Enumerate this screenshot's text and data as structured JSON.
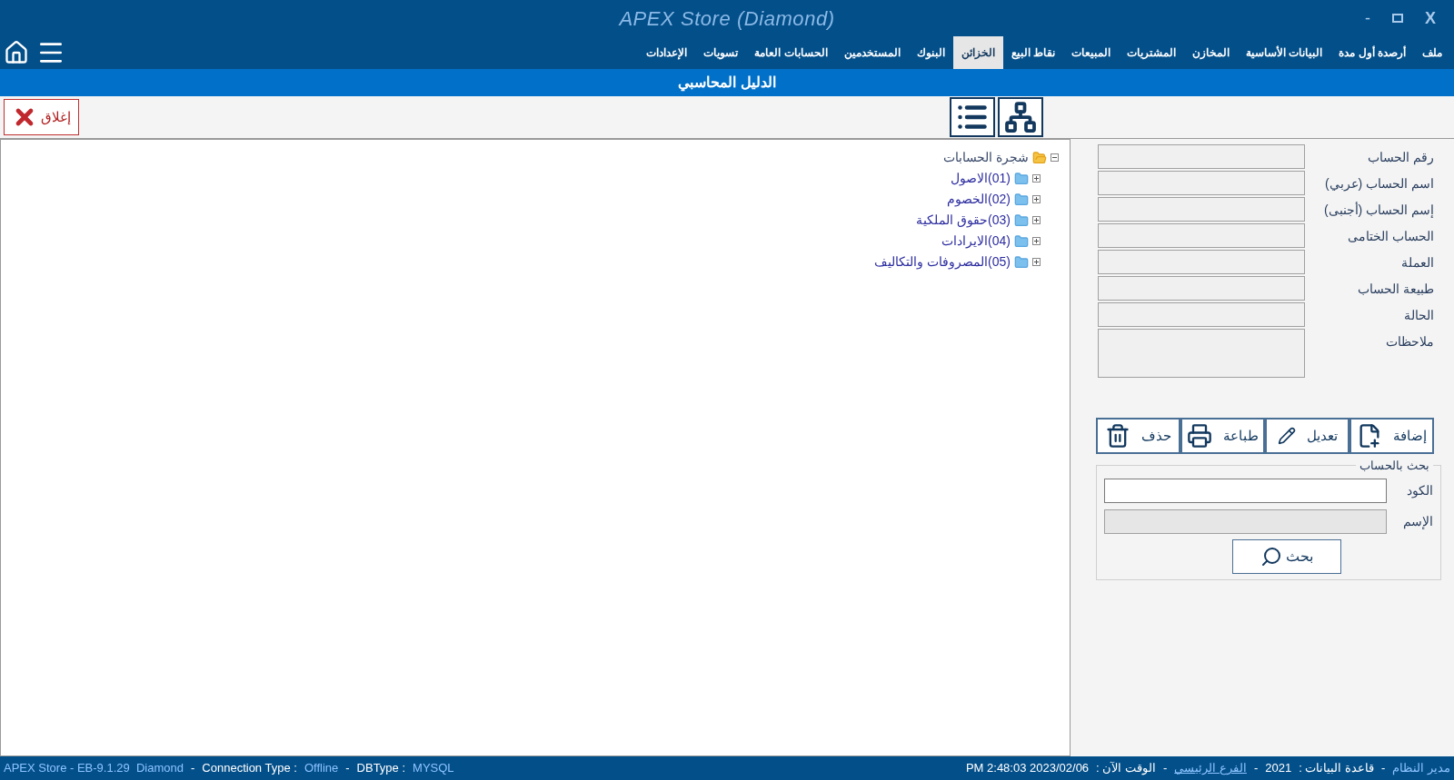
{
  "window": {
    "title": "APEX Store (Diamond)",
    "minimize": "-",
    "close": "X"
  },
  "menu": [
    {
      "label": "ملف",
      "selected": false
    },
    {
      "label": "أرصدة أول مدة",
      "selected": false
    },
    {
      "label": "البيانات الأساسية",
      "selected": false
    },
    {
      "label": "المخازن",
      "selected": false
    },
    {
      "label": "المشتريات",
      "selected": false
    },
    {
      "label": "المبيعات",
      "selected": false
    },
    {
      "label": "نقاط البيع",
      "selected": false
    },
    {
      "label": "الخزائن",
      "selected": true
    },
    {
      "label": "البنوك",
      "selected": false
    },
    {
      "label": "المستخدمين",
      "selected": false
    },
    {
      "label": "الحسابات العامة",
      "selected": false
    },
    {
      "label": "تسويات",
      "selected": false
    },
    {
      "label": "الإعدادات",
      "selected": false
    }
  ],
  "page_title": "الدليل المحاسبي",
  "close_button": "إغلاق",
  "tree": {
    "label": "شجرة الحسابات",
    "expanded": true,
    "children": [
      {
        "label": "(01)الاصول",
        "expanded": false
      },
      {
        "label": "(02)الخصوم",
        "expanded": false
      },
      {
        "label": "(03)حقوق الملكية",
        "expanded": false
      },
      {
        "label": "(04)الايرادات",
        "expanded": false
      },
      {
        "label": "(05)المصروفات والتكاليف",
        "expanded": false
      }
    ]
  },
  "form": [
    {
      "label": "رقم الحساب",
      "kind": "line",
      "disabled": true
    },
    {
      "label": "اسم الحساب (عربي)",
      "kind": "line",
      "disabled": true
    },
    {
      "label": "إسم الحساب (أجنبى)",
      "kind": "line",
      "disabled": true
    },
    {
      "label": "الحساب الختامى",
      "kind": "line",
      "disabled": true
    },
    {
      "label": "العملة",
      "kind": "line",
      "disabled": true
    },
    {
      "label": "طبيعة الحساب",
      "kind": "line",
      "disabled": true
    },
    {
      "label": "الحالة",
      "kind": "line",
      "disabled": true
    },
    {
      "label": "ملاحظات",
      "kind": "multiline",
      "disabled": true
    }
  ],
  "actions": [
    {
      "label": "إضافة",
      "kind": "add"
    },
    {
      "label": "تعديل",
      "kind": "edit"
    },
    {
      "label": "طباعة",
      "kind": "print"
    },
    {
      "label": "حذف",
      "kind": "delete"
    }
  ],
  "search": {
    "title": "بحث بالحساب",
    "fields": [
      {
        "label": "الكود",
        "disabled": false
      },
      {
        "label": "الإسم",
        "disabled": true
      }
    ],
    "button": "بحث"
  },
  "status_bar": {
    "left": {
      "product": "APEX Store - EB-9.1.29  Diamond",
      "separator_1": "-",
      "connection": {
        "label": "Connection Type :",
        "value": "Offline"
      },
      "separator_2": "-",
      "database": {
        "label": "DBType :",
        "value": "MYSQL"
      }
    },
    "right": [
      {
        "text": "مدير النظام",
        "kind": "value"
      },
      {
        "text": "-",
        "kind": "sep"
      },
      {
        "text": "قاعدة البيانات :",
        "kind": "label"
      },
      {
        "text": "2021",
        "kind": "label"
      },
      {
        "text": "-",
        "kind": "sep"
      },
      {
        "text": "الفرع الرئيسي",
        "kind": "link"
      },
      {
        "text": "-",
        "kind": "sep"
      },
      {
        "text": "الوقت الآن :",
        "kind": "label"
      },
      {
        "text": "PM 2:48:03 2023/02/06",
        "kind": "label"
      }
    ]
  }
}
